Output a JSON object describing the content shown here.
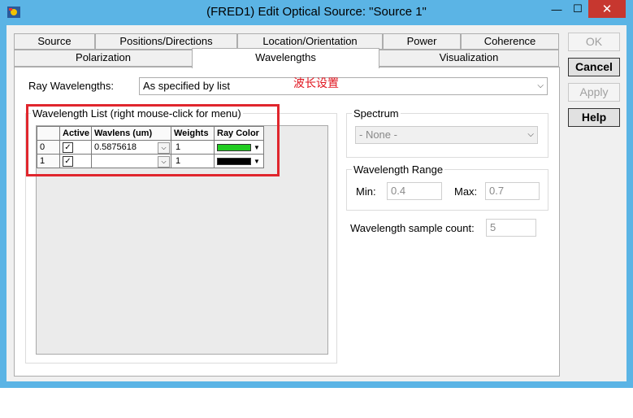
{
  "window": {
    "title": "(FRED1) Edit Optical Source: \"Source 1\"",
    "close_symbol": "✕",
    "min_symbol": "—",
    "max_symbol": "☐"
  },
  "tabs_row1": [
    "Source",
    "Positions/Directions",
    "Location/Orientation",
    "Power",
    "Coherence"
  ],
  "tabs_row2": [
    "Polarization",
    "Wavelengths",
    "Visualization"
  ],
  "selected_tab": "Wavelengths",
  "buttons": {
    "ok": "OK",
    "cancel": "Cancel",
    "apply": "Apply",
    "help": "Help"
  },
  "ray_wavelengths": {
    "label": "Ray Wavelengths:",
    "value": "As specified by list"
  },
  "annotation": "波长设置",
  "wavelength_list": {
    "title": "Wavelength List (right mouse-click for menu)",
    "columns": [
      "Active",
      "Wavlens (um)",
      "Weights",
      "Ray Color"
    ],
    "rows": [
      {
        "index": "0",
        "active": true,
        "wavelength": "0.5875618",
        "weight": "1",
        "color": "#22cc22"
      },
      {
        "index": "1",
        "active": true,
        "wavelength": "",
        "weight": "1",
        "color": "#000000"
      }
    ]
  },
  "spectrum": {
    "title": "Spectrum",
    "value": "- None -"
  },
  "wavelength_range": {
    "title": "Wavelength Range",
    "min_label": "Min:",
    "min_value": "0.4",
    "max_label": "Max:",
    "max_value": "0.7"
  },
  "sample_count": {
    "label": "Wavelength sample count:",
    "value": "5"
  },
  "colors": {
    "highlight": "#e0262d",
    "titlebar": "#5bb4e5",
    "close": "#c7372f"
  }
}
